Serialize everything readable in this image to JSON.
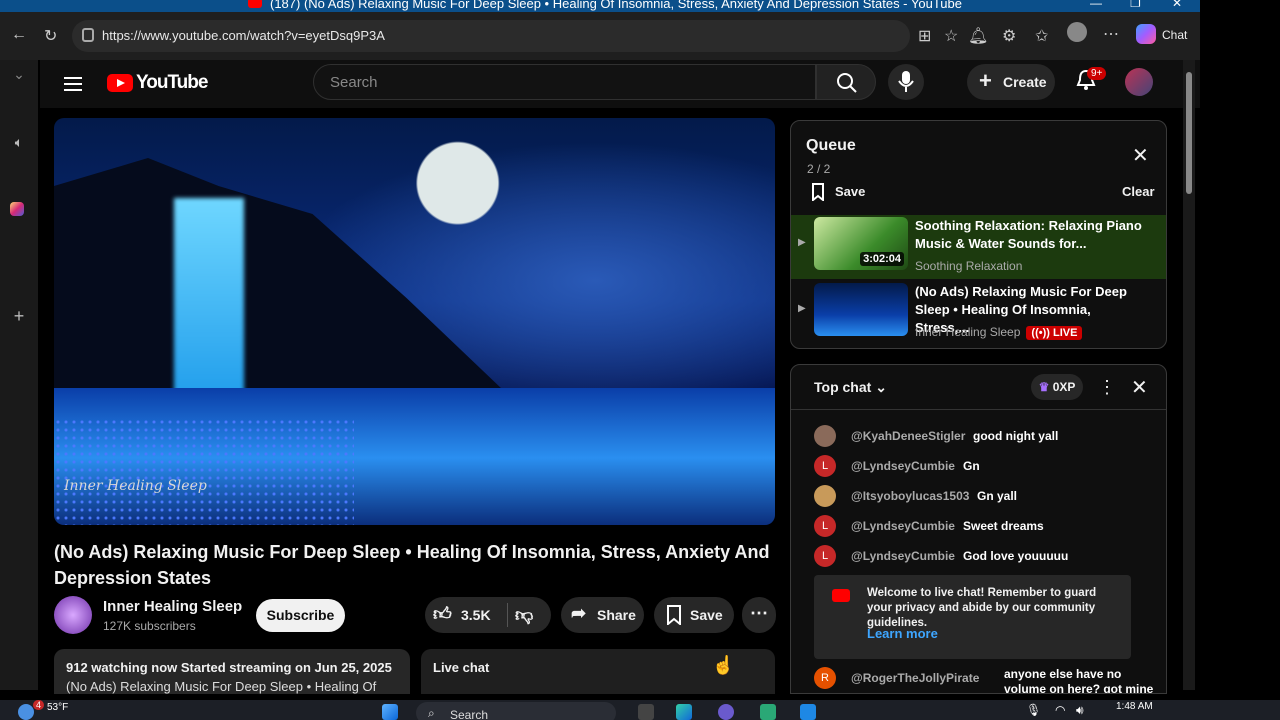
{
  "window": {
    "title": "(187) (No Ads) Relaxing Music For Deep Sleep • Healing Of Insomnia, Stress, Anxiety And Depression States - YouTube"
  },
  "browser": {
    "url": "https://www.youtube.com/watch?v=eyetDsq9P3A",
    "chat_label": "Chat"
  },
  "youtube": {
    "logo_text": "YouTube",
    "search_placeholder": "Search",
    "create_label": "Create",
    "notif_badge": "9+"
  },
  "video": {
    "watermark": "Inner Healing Sleep",
    "title": "(No Ads) Relaxing Music For Deep Sleep • Healing Of Insomnia, Stress, Anxiety And Depression States",
    "channel_name": "Inner Healing Sleep",
    "subscribers": "127K subscribers",
    "subscribe_label": "Subscribe",
    "likes": "3.5K",
    "share_label": "Share",
    "save_label": "Save",
    "desc_line1": "912 watching now  Started streaming on Jun 25, 2025",
    "desc_line2": "(No Ads) Relaxing Music For Deep Sleep • Healing Of",
    "live_chat_label": "Live chat"
  },
  "queue": {
    "title": "Queue",
    "count": "2 / 2",
    "save_label": "Save",
    "clear_label": "Clear",
    "items": [
      {
        "title": "Soothing Relaxation: Relaxing Piano Music & Water Sounds for...",
        "channel": "Soothing Relaxation",
        "duration": "3:02:04"
      },
      {
        "title": "(No Ads) Relaxing Music For Deep Sleep • Healing Of Insomnia, Stress,...",
        "channel": "Inner Healing Sleep",
        "live": "LIVE"
      }
    ]
  },
  "chat": {
    "mode": "Top chat",
    "xp": "0XP",
    "messages": [
      {
        "author": "@KyahDeneeStigler",
        "text": "good night yall",
        "initial": "",
        "color": "#8a6a5a"
      },
      {
        "author": "@LyndseyCumbie",
        "text": "Gn",
        "initial": "L",
        "color": "#c62828"
      },
      {
        "author": "@Itsyoboylucas1503",
        "text": "Gn yall",
        "initial": "",
        "color": "#c89a5a"
      },
      {
        "author": "@LyndseyCumbie",
        "text": "Sweet dreams",
        "initial": "L",
        "color": "#c62828"
      },
      {
        "author": "@LyndseyCumbie",
        "text": "God love youuuuu",
        "initial": "L",
        "color": "#c62828"
      }
    ],
    "welcome": "Welcome to live chat! Remember to guard your privacy and abide by our community guidelines.",
    "learn_more": "Learn more",
    "last": {
      "author": "@RogerTheJollyPirate",
      "text": "anyone else have no volume on here? got mine turned all the way up and",
      "initial": "R",
      "color": "#e65100"
    }
  },
  "taskbar": {
    "temp": "53°F",
    "search": "Search",
    "time": "1:48 AM",
    "weather_badge": "4"
  }
}
